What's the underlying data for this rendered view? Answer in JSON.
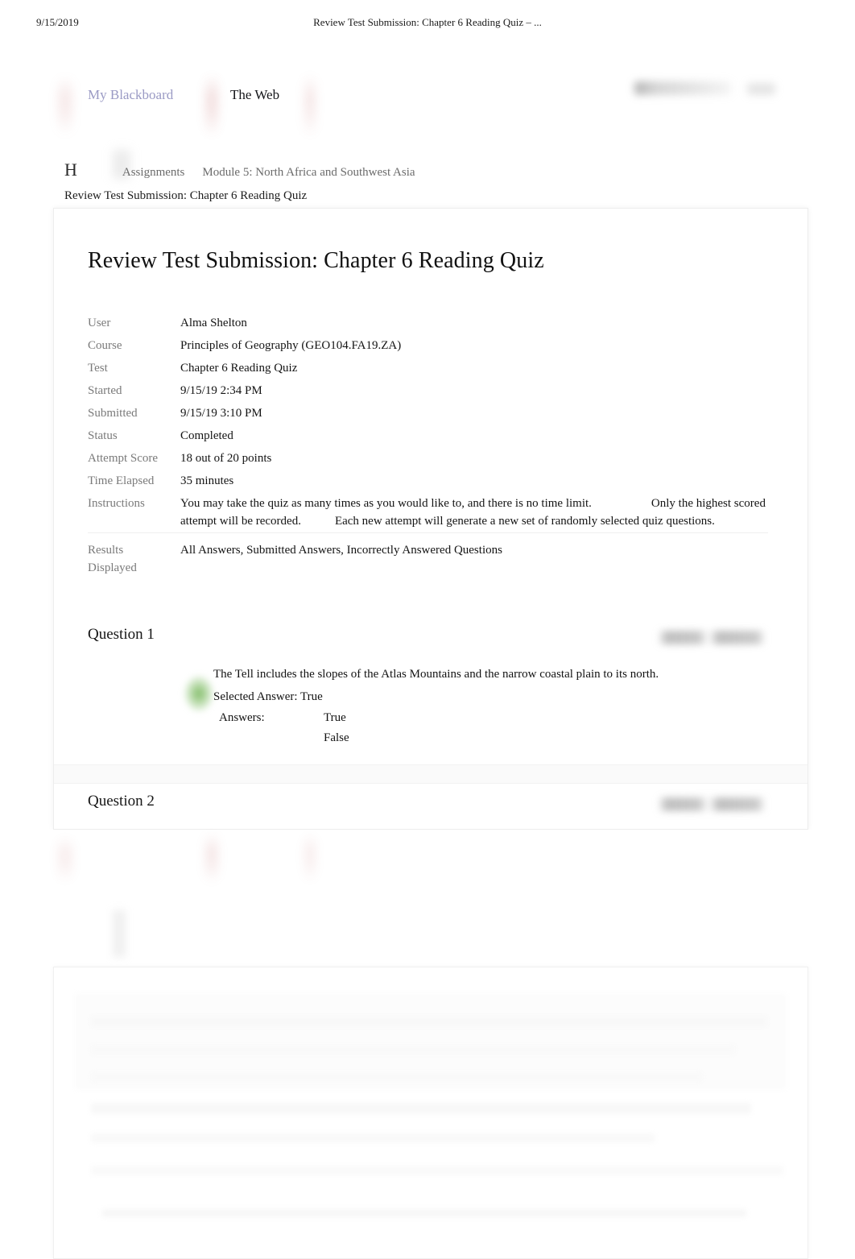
{
  "print_header": {
    "date": "9/15/2019",
    "title": "Review Test Submission: Chapter 6 Reading Quiz – ..."
  },
  "site_nav": {
    "tabs": [
      {
        "label": "My Blackboard",
        "color": "#9a9ac4"
      },
      {
        "label": "The Web",
        "color": "#15161a"
      }
    ]
  },
  "breadcrumb": {
    "home": "H",
    "items": [
      "Assignments",
      "Module 5: North Africa and Southwest Asia"
    ],
    "current": "Review Test Submission: Chapter 6 Reading Quiz"
  },
  "page_title": "Review Test Submission: Chapter 6 Reading Quiz",
  "info": {
    "rows": [
      {
        "label": "User",
        "value": "Alma Shelton"
      },
      {
        "label": "Course",
        "value": "Principles of Geography (GEO104.FA19.ZA)"
      },
      {
        "label": "Test",
        "value": "Chapter 6 Reading Quiz"
      },
      {
        "label": "Started",
        "value": "9/15/19 2:34 PM"
      },
      {
        "label": "Submitted",
        "value": "9/15/19 3:10 PM"
      },
      {
        "label": "Status",
        "value": "Completed"
      },
      {
        "label": "Attempt Score",
        "value": "18 out of 20 points"
      },
      {
        "label": "Time Elapsed",
        "value": "35 minutes"
      }
    ],
    "instructions": {
      "label": "Instructions",
      "part1": "You may take the quiz as many times as you would like to, and there is no time limit.",
      "part2": "Only the highest scored attempt will be recorded.",
      "part3": "Each new attempt will generate a new set of randomly selected quiz questions."
    },
    "results_displayed": {
      "label": "Results Displayed",
      "value": "All Answers, Submitted Answers, Incorrectly Answered Questions"
    }
  },
  "questions": [
    {
      "title": "Question 1",
      "points": "",
      "text": "The Tell includes the slopes of the Atlas Mountains and the narrow coastal plain to its north.",
      "selected_label": "Selected Answer:",
      "selected_value": "True",
      "answers_label": "Answers:",
      "answers": [
        "True",
        "False"
      ]
    },
    {
      "title": "Question 2",
      "points": "",
      "text": "",
      "selected_label": "",
      "selected_value": "",
      "answers_label": "",
      "answers": []
    }
  ],
  "colors": {
    "label_gray": "#7a7a7a",
    "text_black": "#131313",
    "correct_green": "#6ab04c",
    "link_lavender": "#9a9ac4"
  }
}
